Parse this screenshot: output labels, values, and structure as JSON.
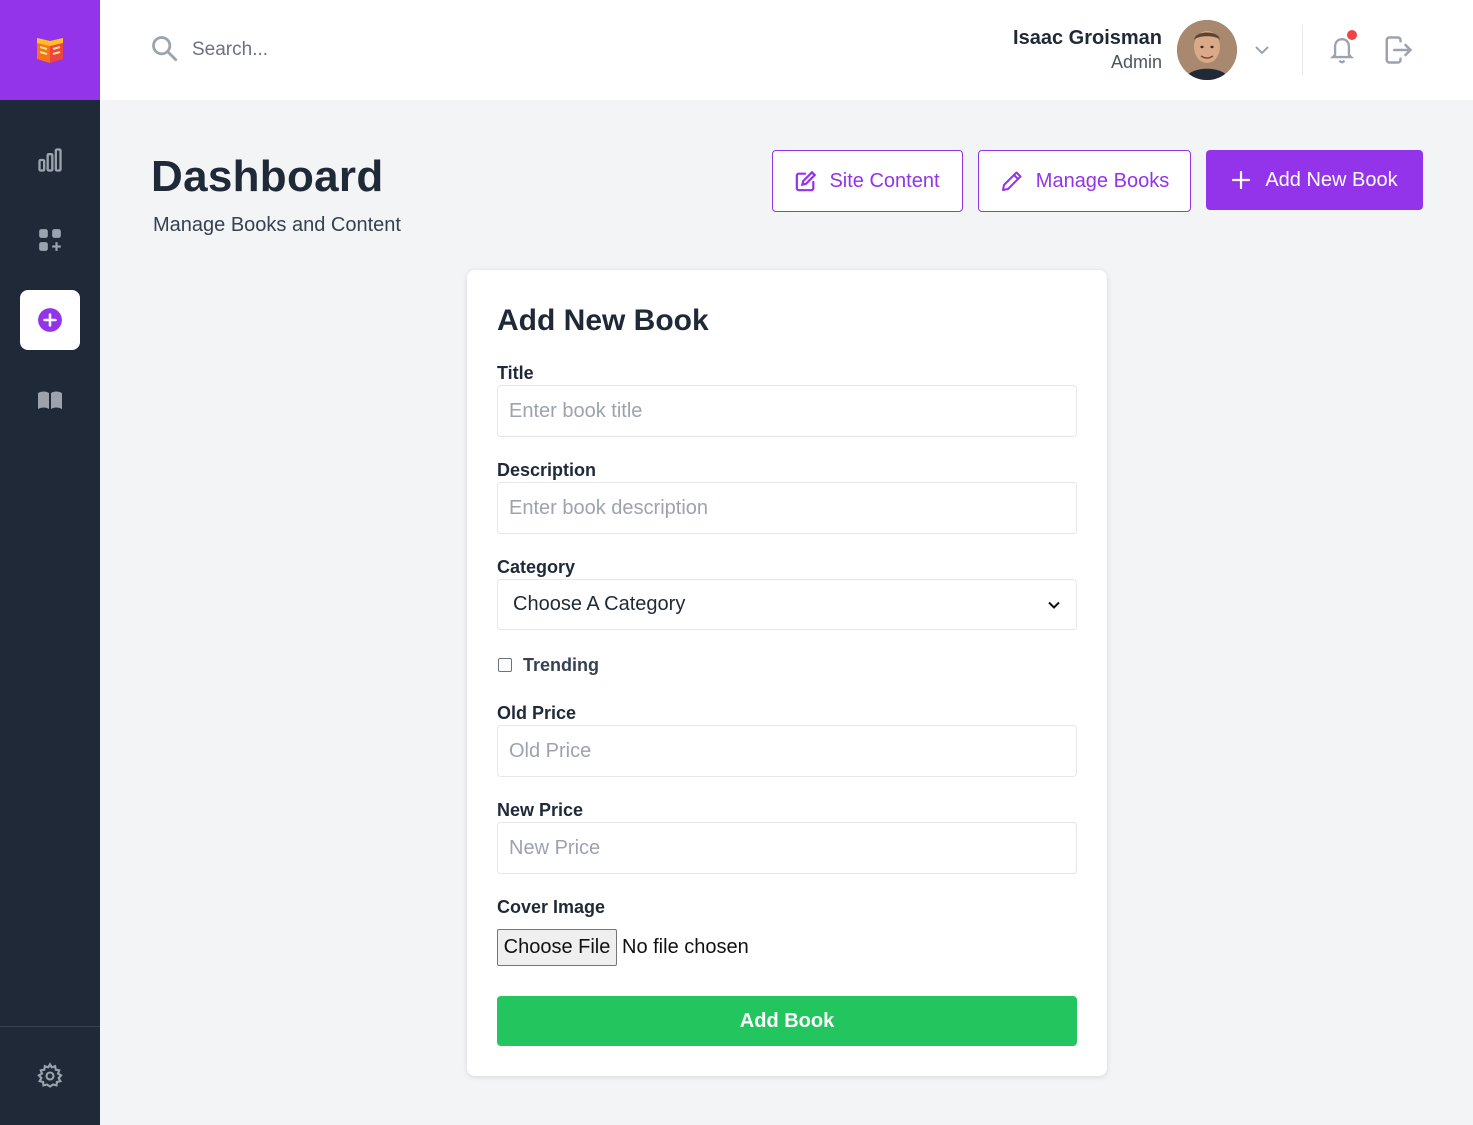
{
  "header": {
    "search_placeholder": "Search...",
    "user_name": "Isaac Groisman",
    "user_role": "Admin"
  },
  "page": {
    "title": "Dashboard",
    "subtitle": "Manage Books and Content"
  },
  "actions": {
    "site_content": "Site Content",
    "manage_books": "Manage Books",
    "add_new_book": "Add New Book"
  },
  "form": {
    "title": "Add New Book",
    "title_label": "Title",
    "title_placeholder": "Enter book title",
    "description_label": "Description",
    "description_placeholder": "Enter book description",
    "category_label": "Category",
    "category_value": "Choose A Category",
    "trending_label": "Trending",
    "old_price_label": "Old Price",
    "old_price_placeholder": "Old Price",
    "new_price_label": "New Price",
    "new_price_placeholder": "New Price",
    "cover_label": "Cover Image",
    "choose_file": "Choose File",
    "file_status": "No file chosen",
    "submit": "Add Book"
  },
  "colors": {
    "accent": "#9333ea",
    "sidebar": "#1f2937",
    "submit": "#22c55e",
    "notification_dot": "#ef4444"
  },
  "icons": [
    "book-logo-icon",
    "bar-chart-icon",
    "grid-add-icon",
    "plus-circle-icon",
    "open-book-icon",
    "gear-icon",
    "search-icon",
    "chevron-down-icon",
    "bell-icon",
    "logout-icon",
    "edit-icon",
    "pencil-icon",
    "plus-icon"
  ]
}
